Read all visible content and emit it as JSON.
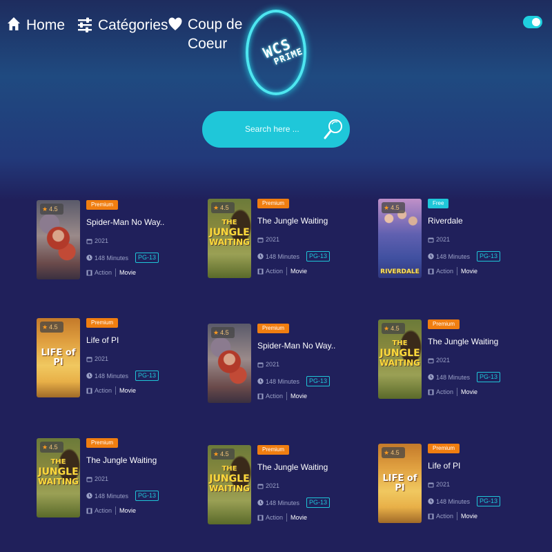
{
  "nav": {
    "home": "Home",
    "categories": "Catégories",
    "favorites": "Coup de Coeur"
  },
  "logo": {
    "line1": "WCS",
    "line2": "PRIME"
  },
  "search": {
    "placeholder": "Search here ..."
  },
  "theme_toggle": {
    "on": true
  },
  "colors": {
    "accent": "#1fc7d9",
    "premium": "#f07e10",
    "background": "#20205b"
  },
  "cards": [
    {
      "badge": "Premium",
      "title": "Spider-Man No Way..",
      "year": "2021",
      "duration": "148 Minutes",
      "rating_badge": "PG-13",
      "genre": "Action",
      "type": "Movie",
      "score": "4.5",
      "poster": "spiderman"
    },
    {
      "badge": "Premium",
      "title": "The Jungle Waiting",
      "year": "2021",
      "duration": "148 Minutes",
      "rating_badge": "PG-13",
      "genre": "Action",
      "type": "Movie",
      "score": "4.5",
      "poster": "jungle"
    },
    {
      "badge": "Free",
      "title": "Riverdale",
      "year": "2021",
      "duration": "148 Minutes",
      "rating_badge": "PG-13",
      "genre": "Action",
      "type": "Movie",
      "score": "4.5",
      "poster": "riverdale"
    },
    {
      "badge": "Premium",
      "title": "Life of PI",
      "year": "2021",
      "duration": "148 Minutes",
      "rating_badge": "PG-13",
      "genre": "Action",
      "type": "Movie",
      "score": "4.5",
      "poster": "lifeofpi"
    },
    {
      "badge": "Premium",
      "title": "Spider-Man No Way..",
      "year": "2021",
      "duration": "148 Minutes",
      "rating_badge": "PG-13",
      "genre": "Action",
      "type": "Movie",
      "score": "4.5",
      "poster": "spiderman"
    },
    {
      "badge": "Premium",
      "title": "The Jungle Waiting",
      "year": "2021",
      "duration": "148 Minutes",
      "rating_badge": "PG-13",
      "genre": "Action",
      "type": "Movie",
      "score": "4.5",
      "poster": "jungle"
    },
    {
      "badge": "Premium",
      "title": "The Jungle Waiting",
      "year": "2021",
      "duration": "148 Minutes",
      "rating_badge": "PG-13",
      "genre": "Action",
      "type": "Movie",
      "score": "4.5",
      "poster": "jungle"
    },
    {
      "badge": "Premium",
      "title": "The Jungle Waiting",
      "year": "2021",
      "duration": "148 Minutes",
      "rating_badge": "PG-13",
      "genre": "Action",
      "type": "Movie",
      "score": "4.5",
      "poster": "jungle"
    },
    {
      "badge": "Premium",
      "title": "Life of PI",
      "year": "2021",
      "duration": "148 Minutes",
      "rating_badge": "PG-13",
      "genre": "Action",
      "type": "Movie",
      "score": "4.5",
      "poster": "lifeofpi"
    }
  ],
  "poster_text": {
    "jungle": [
      "THE",
      "JUNGLE",
      "WAITING"
    ],
    "riverdale": [
      "RIVERDALE"
    ],
    "lifeofpi": [
      "LIFE of PI"
    ]
  }
}
